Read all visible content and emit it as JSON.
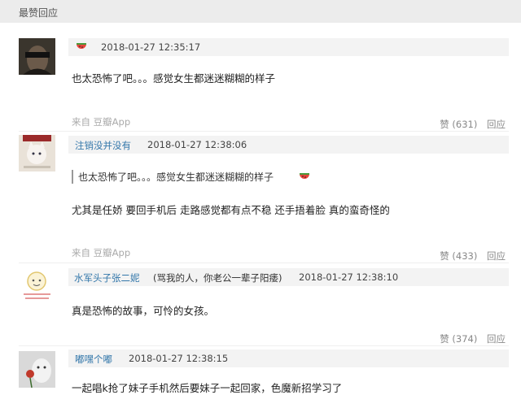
{
  "header": {
    "title": "最赞回应"
  },
  "comments": [
    {
      "time": "2018-01-27 12:35:17",
      "text": "也太恐怖了吧。。。感觉女生都迷迷糊糊的样子",
      "source": "来自 豆瓣App",
      "likes": "赞 (631)",
      "reply": "回应"
    },
    {
      "user": "注销没并没有",
      "time": "2018-01-27 12:38:06",
      "quote": "也太恐怖了吧。。。感觉女生都迷迷糊糊的样子",
      "text": "尤其是任娇 要回手机后 走路感觉都有点不稳 还手捂着脸 真的蛮奇怪的",
      "source": "来自 豆瓣App",
      "likes": "赞 (433)",
      "reply": "回应"
    },
    {
      "user": "水军头子张二妮",
      "note": "(骂我的人，你老公一辈子阳痿)",
      "time": "2018-01-27 12:38:10",
      "text": "真是恐怖的故事，可怜的女孩。",
      "likes": "赞 (374)",
      "reply": "回应"
    },
    {
      "user": "嘟嘿个嘟",
      "time": "2018-01-27 12:38:15",
      "text": "一起唱k抢了妹子手机然后要妹子一起回家，色魔新招学习了"
    }
  ],
  "colors": {
    "link": "#3377aa",
    "meta_bg": "#f3f3f3",
    "header_bg": "#ececec"
  }
}
